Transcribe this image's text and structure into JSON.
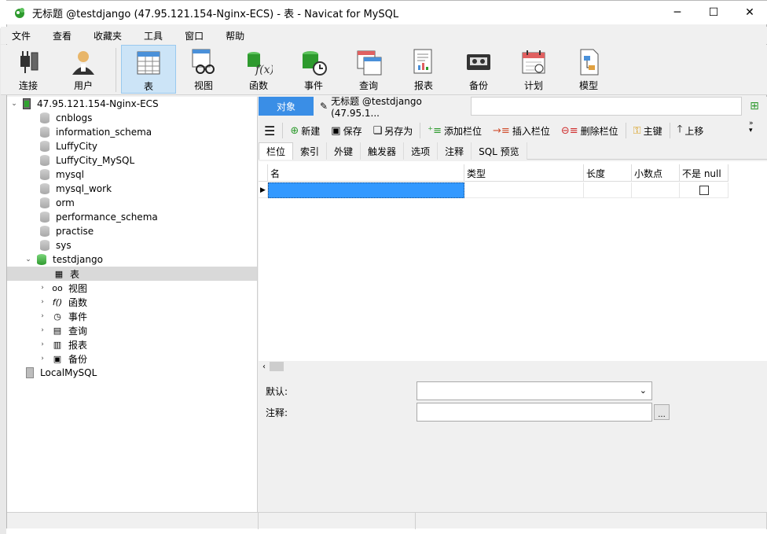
{
  "window": {
    "title": "无标题 @testdjango (47.95.121.154-Nginx-ECS) - 表 - Navicat for MySQL",
    "min_label": "─",
    "max_label": "☐",
    "close_label": "✕",
    "brand_color": "#2e9a2e"
  },
  "menu": [
    "文件",
    "查看",
    "收藏夹",
    "工具",
    "窗口",
    "帮助"
  ],
  "toolbar": [
    {
      "label": "连接",
      "icon": "plug-icon"
    },
    {
      "label": "用户",
      "icon": "user-icon"
    },
    {
      "label": "表",
      "icon": "table-icon",
      "active": true
    },
    {
      "label": "视图",
      "icon": "view-icon"
    },
    {
      "label": "函数",
      "icon": "function-icon"
    },
    {
      "label": "事件",
      "icon": "event-icon"
    },
    {
      "label": "查询",
      "icon": "query-icon"
    },
    {
      "label": "报表",
      "icon": "report-icon"
    },
    {
      "label": "备份",
      "icon": "backup-icon"
    },
    {
      "label": "计划",
      "icon": "schedule-icon"
    },
    {
      "label": "模型",
      "icon": "model-icon"
    }
  ],
  "tree": {
    "server": "47.95.121.154-Nginx-ECS",
    "databases": [
      "cnblogs",
      "information_schema",
      "LuffyCity",
      "LuffyCity_MySQL",
      "mysql",
      "mysql_work",
      "orm",
      "performance_schema",
      "practise",
      "sys"
    ],
    "open_db": "testdjango",
    "children": [
      {
        "label": "表",
        "icon": "table-icon"
      },
      {
        "label": "视图",
        "icon": "view-icon"
      },
      {
        "label": "函数",
        "icon": "function-icon"
      },
      {
        "label": "事件",
        "icon": "event-icon"
      },
      {
        "label": "查询",
        "icon": "query-icon"
      },
      {
        "label": "报表",
        "icon": "report-icon"
      },
      {
        "label": "备份",
        "icon": "backup-icon"
      }
    ],
    "local": "LocalMySQL"
  },
  "tabs": {
    "object": "对象",
    "doc": "无标题 @testdjango (47.95.1..."
  },
  "subtoolbar": {
    "new": "新建",
    "save": "保存",
    "save_as": "另存为",
    "add_col": "添加栏位",
    "insert_col": "插入栏位",
    "delete_col": "删除栏位",
    "primary_key": "主键",
    "move_up": "上移"
  },
  "panel_tabs": [
    "栏位",
    "索引",
    "外键",
    "触发器",
    "选项",
    "注释",
    "SQL 预览"
  ],
  "grid": {
    "headers": [
      "名",
      "类型",
      "长度",
      "小数点",
      "不是 null"
    ],
    "row_marker": "▶"
  },
  "props": {
    "default_label": "默认:",
    "comment_label": "注释:",
    "dots": "..."
  }
}
